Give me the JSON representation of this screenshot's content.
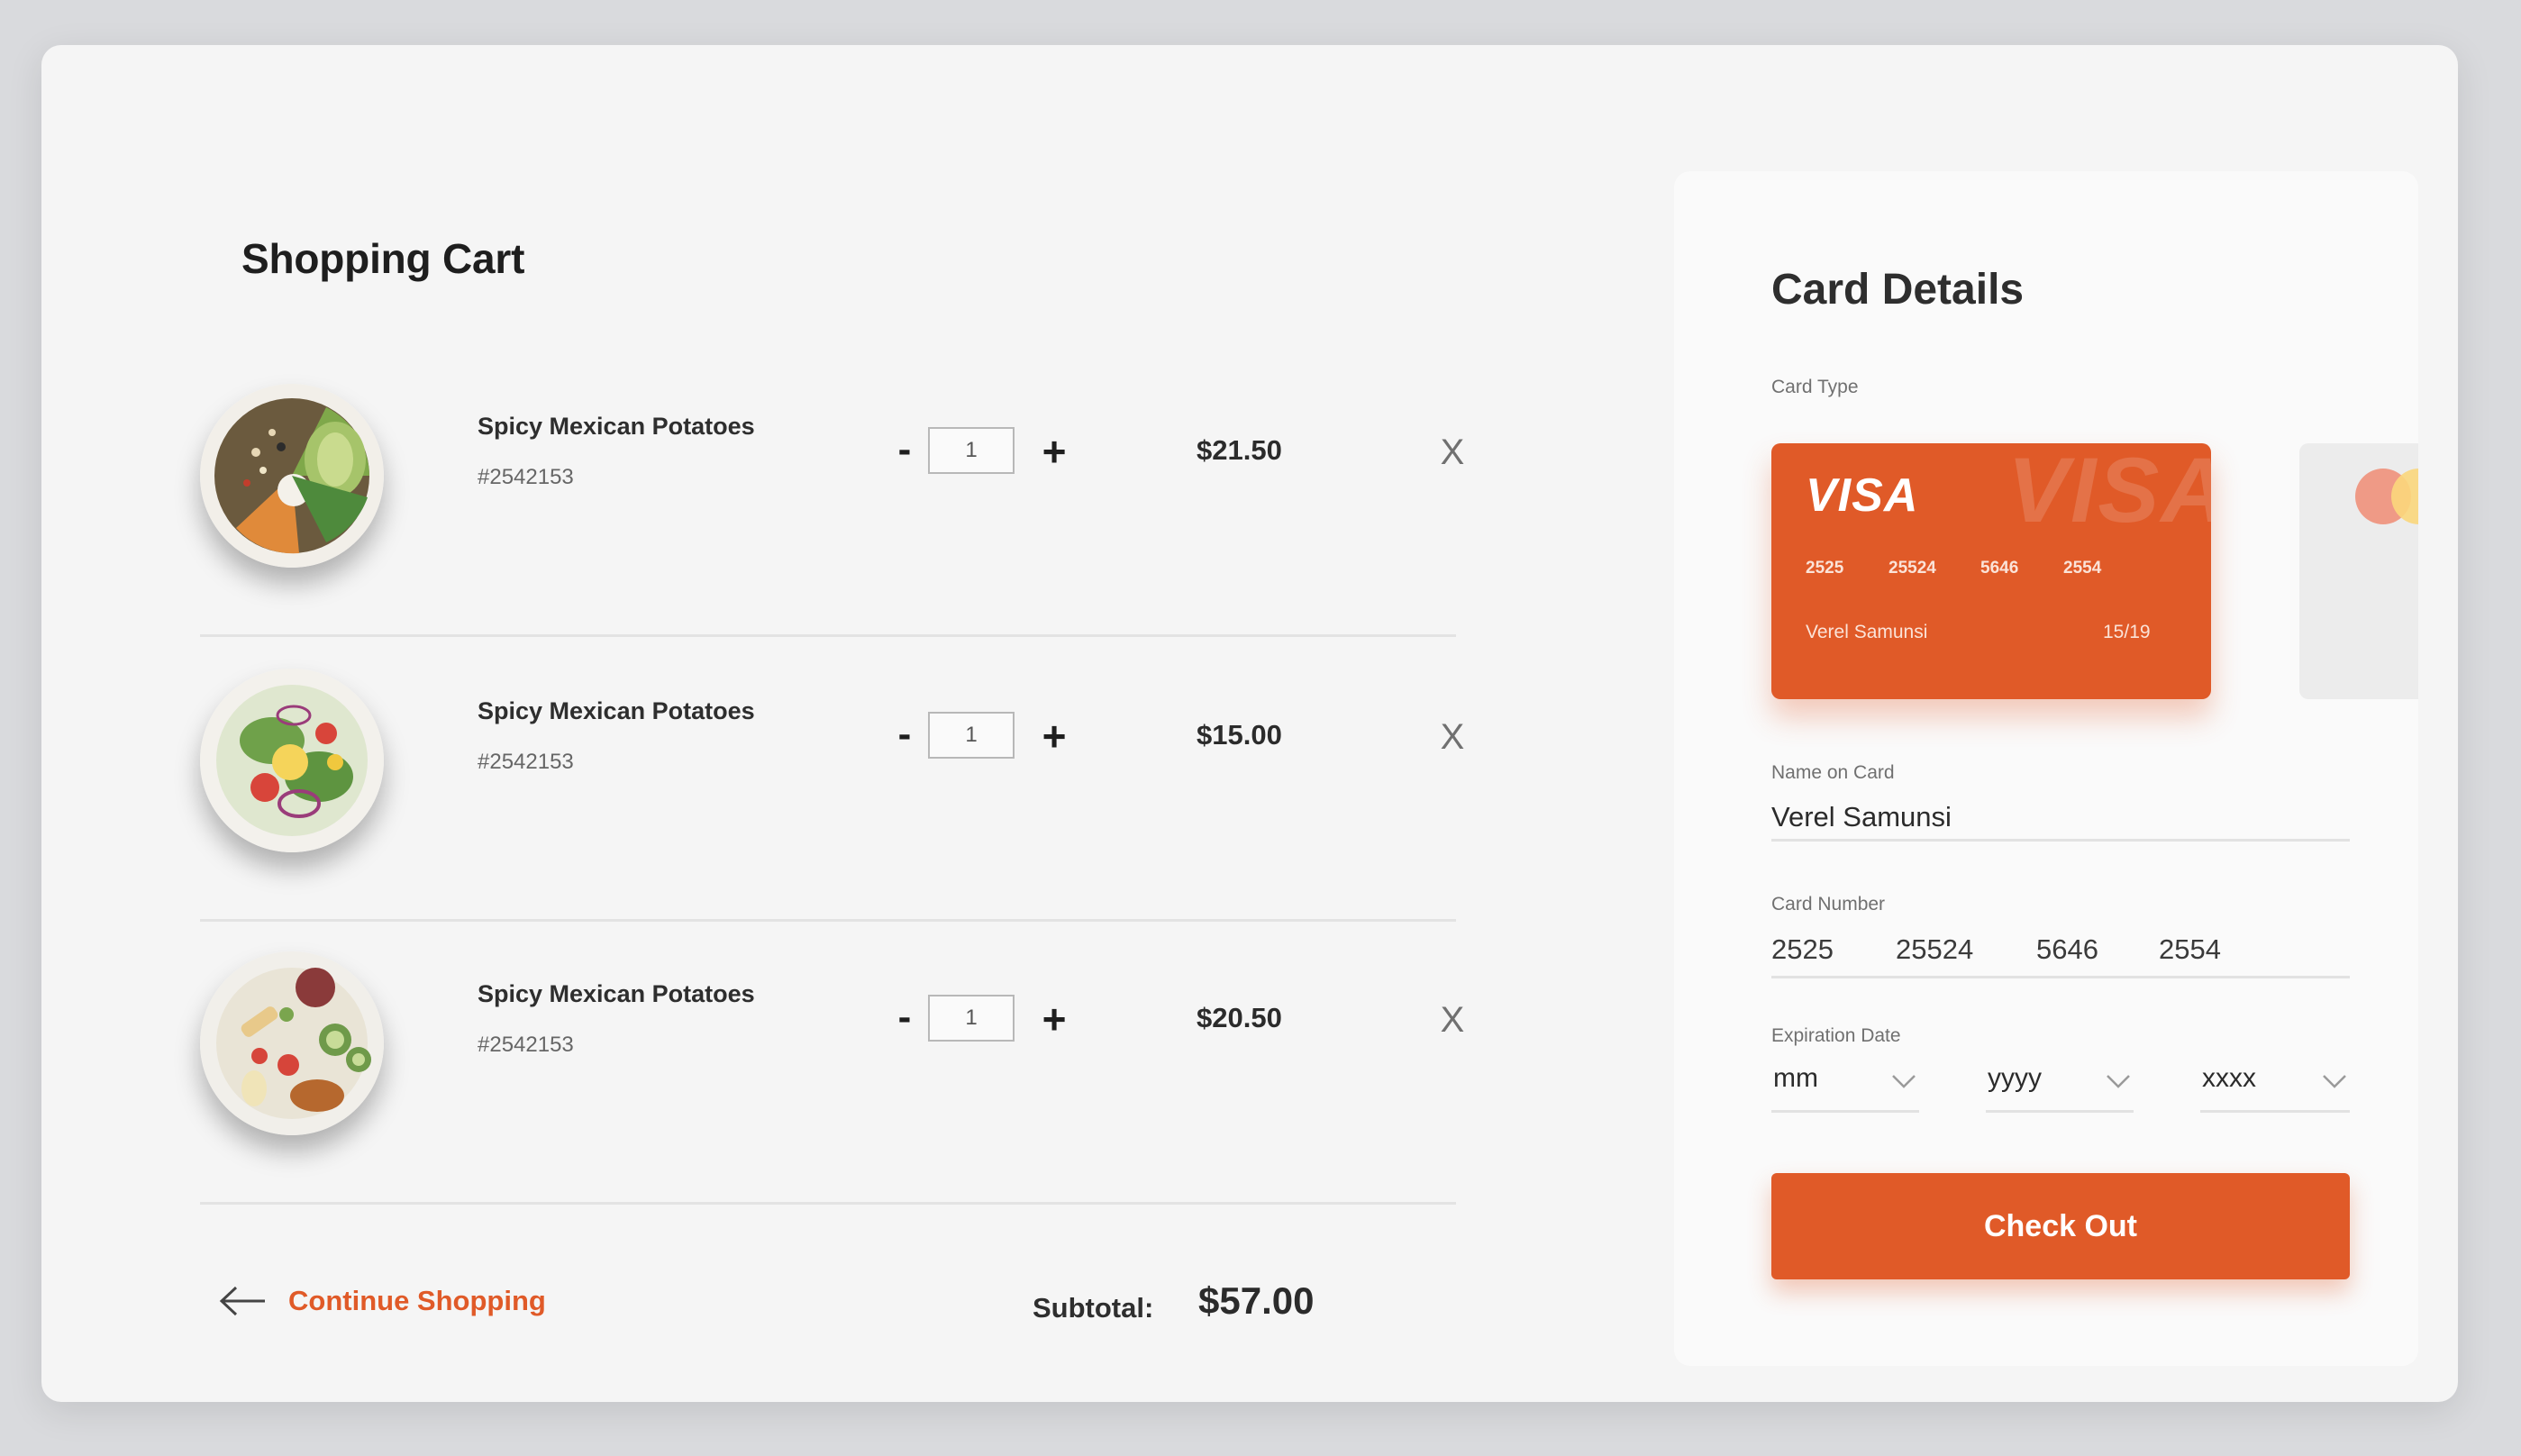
{
  "cart": {
    "title": "Shopping Cart",
    "items": [
      {
        "name": "Spicy Mexican Potatoes",
        "sku": "#2542153",
        "quantity": "1",
        "price": "$21.50",
        "minus": "-",
        "plus": "+",
        "remove": "X"
      },
      {
        "name": "Spicy Mexican Potatoes",
        "sku": "#2542153",
        "quantity": "1",
        "price": "$15.00",
        "minus": "-",
        "plus": "+",
        "remove": "X"
      },
      {
        "name": "Spicy Mexican Potatoes",
        "sku": "#2542153",
        "quantity": "1",
        "price": "$20.50",
        "minus": "-",
        "plus": "+",
        "remove": "X"
      }
    ],
    "continue_label": "Continue Shopping",
    "subtotal_label": "Subtotal:",
    "subtotal_value": "$57.00"
  },
  "card_panel": {
    "title": "Card Details",
    "card_type_label": "Card Type",
    "card": {
      "brand": "VISA",
      "watermark": "VISA",
      "number_groups": [
        "2525",
        "25524",
        "5646",
        "2554"
      ],
      "holder": "Verel Samunsi",
      "expiry": "15/19"
    },
    "name_label": "Name on Card",
    "name_value": "Verel Samunsi",
    "number_label": "Card Number",
    "number_groups": [
      "2525",
      "25524",
      "5646",
      "2554"
    ],
    "expiration_label": "Expiration Date",
    "expiration": {
      "month": "mm",
      "year": "yyyy",
      "cvv": "xxxx"
    },
    "checkout_label": "Check Out"
  },
  "icons": {
    "back": "arrow-left-icon",
    "dropdown": "chevron-down-icon",
    "alt_card": "mastercard-icon"
  },
  "colors": {
    "accent": "#e05a28",
    "background": "#f5f5f5",
    "panel": "#fafafa",
    "text": "#2b2b2b"
  }
}
